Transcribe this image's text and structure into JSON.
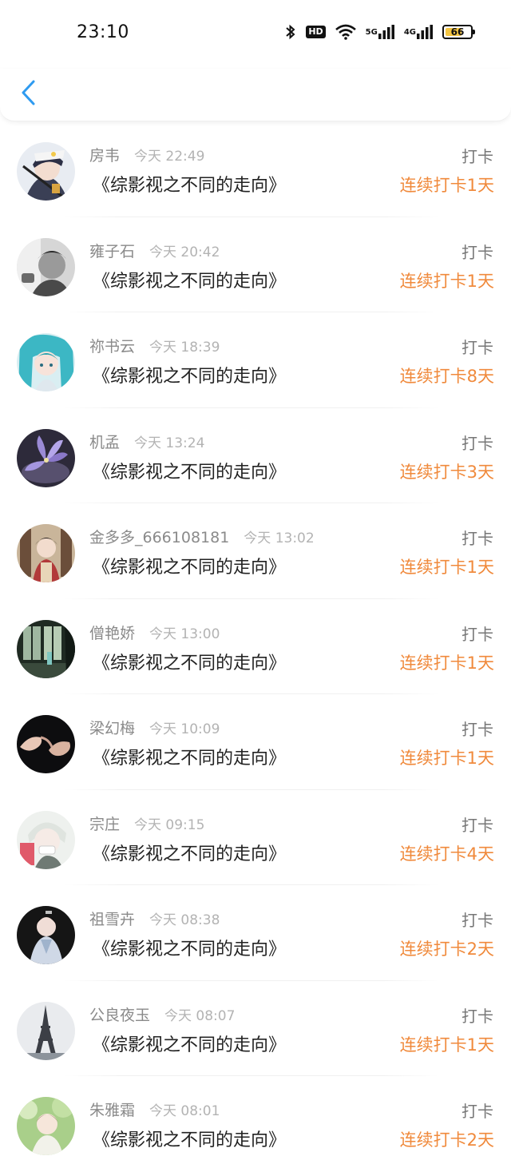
{
  "status_bar": {
    "time": "23:10",
    "hd_label": "HD",
    "net1_label": "5G",
    "net2_label": "4G",
    "battery": "66",
    "battery_color": "#f4c542"
  },
  "nav": {
    "back_icon": "chevron-left-icon",
    "accent": "#2f9bf0"
  },
  "colors": {
    "streak": "#f08a3c",
    "name": "#8a8a8a",
    "time": "#b3b3b3",
    "title": "#222222",
    "action": "#777777"
  },
  "entries": [
    {
      "name": "房韦",
      "time": "今天 22:49",
      "book": "《综影视之不同的走向》",
      "action": "打卡",
      "streak": "连续打卡1天"
    },
    {
      "name": "雍子石",
      "time": "今天 20:42",
      "book": "《综影视之不同的走向》",
      "action": "打卡",
      "streak": "连续打卡1天"
    },
    {
      "name": "祢书云",
      "time": "今天 18:39",
      "book": "《综影视之不同的走向》",
      "action": "打卡",
      "streak": "连续打卡8天"
    },
    {
      "name": "机孟",
      "time": "今天 13:24",
      "book": "《综影视之不同的走向》",
      "action": "打卡",
      "streak": "连续打卡3天"
    },
    {
      "name": "金多多_666108181",
      "time": "今天 13:02",
      "book": "《综影视之不同的走向》",
      "action": "打卡",
      "streak": "连续打卡1天"
    },
    {
      "name": "僧艳娇",
      "time": "今天 13:00",
      "book": "《综影视之不同的走向》",
      "action": "打卡",
      "streak": "连续打卡1天"
    },
    {
      "name": "梁幻梅",
      "time": "今天 10:09",
      "book": "《综影视之不同的走向》",
      "action": "打卡",
      "streak": "连续打卡1天"
    },
    {
      "name": "宗庄",
      "time": "今天 09:15",
      "book": "《综影视之不同的走向》",
      "action": "打卡",
      "streak": "连续打卡4天"
    },
    {
      "name": "祖雪卉",
      "time": "今天 08:38",
      "book": "《综影视之不同的走向》",
      "action": "打卡",
      "streak": "连续打卡2天"
    },
    {
      "name": "公良夜玉",
      "time": "今天 08:07",
      "book": "《综影视之不同的走向》",
      "action": "打卡",
      "streak": "连续打卡1天"
    },
    {
      "name": "朱雅霜",
      "time": "今天 08:01",
      "book": "《综影视之不同的走向》",
      "action": "打卡",
      "streak": "连续打卡2天"
    }
  ]
}
